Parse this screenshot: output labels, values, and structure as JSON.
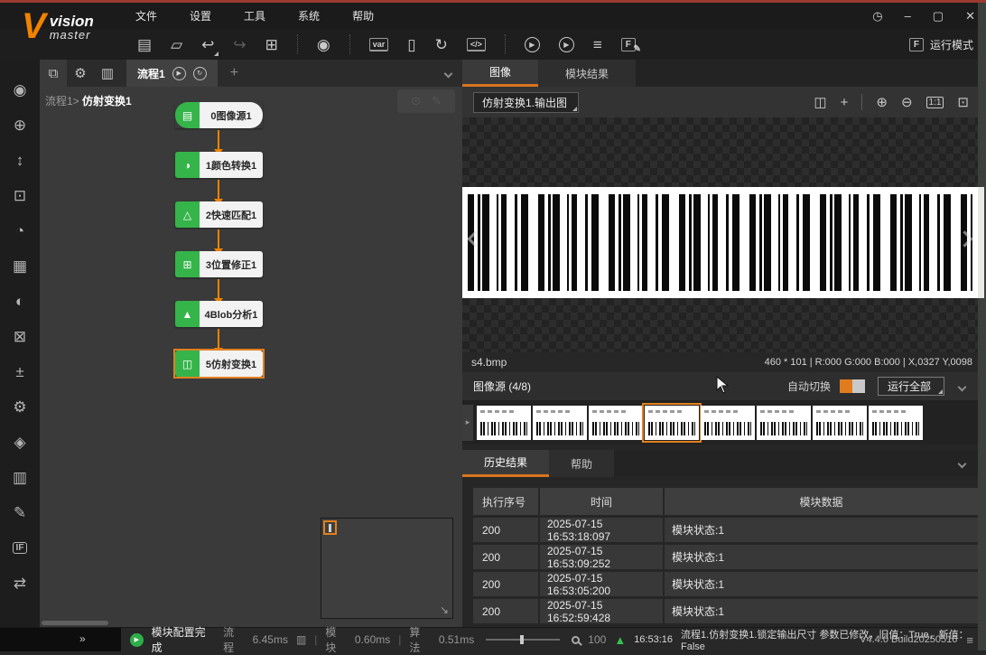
{
  "chrome": {
    "menus": [
      "文件",
      "设置",
      "工具",
      "系统",
      "帮助"
    ],
    "logo_word1": "vision",
    "logo_word2": "master",
    "run_mode_label": "运行模式"
  },
  "icons": {
    "save": "▤",
    "open": "▱",
    "undo": "↩",
    "redo": "↪",
    "frame_lock": "⊞",
    "camera": "◉",
    "var": "var",
    "io_card": "▯",
    "rebuild": "↻",
    "code": "</>",
    "run_once": "▶",
    "run_continuous": "▶",
    "queue": "≡",
    "format_f": "F",
    "pen": "✎",
    "clock": "◷",
    "minimize": "–",
    "maximize": "▢",
    "close": "✕",
    "hierarchy": "⧉",
    "wrench": "⚙",
    "barcode_box": "▥",
    "tab_play": "▶",
    "tab_loop": "↻",
    "tab_add": "+",
    "canvas_zoom": "⊙",
    "canvas_edit": "✎",
    "thumb_scroll": "▸",
    "minimap_resize": "↘",
    "expand": "»",
    "warning": "▲"
  },
  "sidebar": {
    "items": [
      {
        "name": "acquisition",
        "glyph": "◉"
      },
      {
        "name": "location",
        "glyph": "⊕"
      },
      {
        "name": "measure",
        "glyph": "↕"
      },
      {
        "name": "recognition",
        "glyph": "⊡"
      },
      {
        "name": "image-capture-timing",
        "glyph": "◔"
      },
      {
        "name": "feature-points",
        "glyph": "▦"
      },
      {
        "name": "sphere-3d",
        "glyph": "◐"
      },
      {
        "name": "calibration-axis",
        "glyph": "⊠"
      },
      {
        "name": "calculation",
        "glyph": "±"
      },
      {
        "name": "image-settings",
        "glyph": "⚙"
      },
      {
        "name": "color-fill",
        "glyph": "◈"
      },
      {
        "name": "histogram",
        "glyph": "▥"
      },
      {
        "name": "image-edit",
        "glyph": "✎"
      },
      {
        "name": "logic-if",
        "glyph": "IF"
      },
      {
        "name": "communication-branch",
        "glyph": "⇄"
      }
    ]
  },
  "flow": {
    "tab_label": "流程1",
    "breadcrumb_prefix": "流程1>",
    "breadcrumb_current": "仿射变换1",
    "nodes": [
      {
        "label": "0图像源1",
        "glyph": "▤"
      },
      {
        "label": "1颜色转换1",
        "glyph": "◑"
      },
      {
        "label": "2快速匹配1",
        "glyph": "△"
      },
      {
        "label": "3位置修正1",
        "glyph": "⊞"
      },
      {
        "label": "4Blob分析1",
        "glyph": "▲"
      },
      {
        "label": "5仿射变换1",
        "glyph": "◫"
      }
    ]
  },
  "viewer": {
    "tab_image": "图像",
    "tab_module_result": "模块结果",
    "source_select": "仿射变换1.输出图",
    "tools": [
      {
        "name": "compare-view",
        "glyph": "◫"
      },
      {
        "name": "center-view",
        "glyph": "+"
      },
      {
        "name": "zoom-in",
        "glyph": "⊕"
      },
      {
        "name": "zoom-out",
        "glyph": "⊖"
      },
      {
        "name": "actual-size",
        "glyph": "1:1"
      },
      {
        "name": "fit-screen",
        "glyph": "⊡"
      }
    ],
    "filename": "s4.bmp",
    "meta": "460 * 101  |  R:000  G:000  B:000  |  X,0327  Y,0098"
  },
  "source_bar": {
    "label": "图像源 (4/8)",
    "auto_switch": "自动切换",
    "run_all": "运行全部"
  },
  "history": {
    "tab_history": "历史结果",
    "tab_help": "帮助",
    "columns": [
      "执行序号",
      "时间",
      "模块数据"
    ],
    "rows": [
      [
        "200",
        "2025-07-15 16:53:18:097",
        "模块状态:1"
      ],
      [
        "200",
        "2025-07-15 16:53:09:252",
        "模块状态:1"
      ],
      [
        "200",
        "2025-07-15 16:53:05:200",
        "模块状态:1"
      ],
      [
        "200",
        "2025-07-15 16:52:59:428",
        "模块状态:1"
      ]
    ]
  },
  "status_bar": {
    "module_status": "模块配置完成",
    "flow_label": "流程",
    "flow_time": "6.45ms",
    "divider": "|",
    "module_label": "模块",
    "module_time": "0.60ms",
    "algo_label": "算法",
    "algo_time": "0.51ms",
    "zoom_pct": "100",
    "notice_time": "16:53:16",
    "notice": "流程1.仿射变换1.锁定输出尺寸 参数已修改，旧值：True，新值：False",
    "version": "V4.4.0 Build20250516"
  },
  "colors": {
    "accent_orange": "#e2801f",
    "node_green": "#35b44a",
    "arrow_orange": "#ef8200",
    "status_green": "#2fae49",
    "topline_red": "#9c3a30"
  }
}
